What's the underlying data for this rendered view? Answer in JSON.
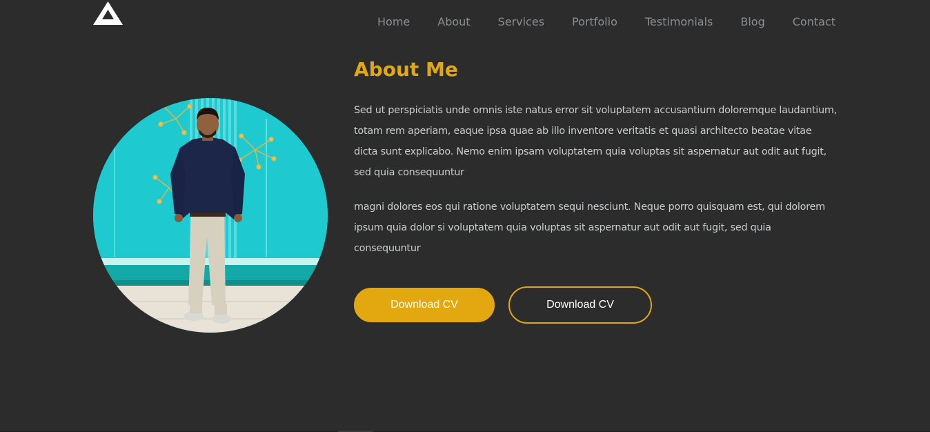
{
  "logo": {
    "icon": "logo-a-icon",
    "color": "#ffffff"
  },
  "nav": {
    "items": [
      "Home",
      "About",
      "Services",
      "Portfolio",
      "Testimonials",
      "Blog",
      "Contact"
    ]
  },
  "about": {
    "title": "About Me",
    "paragraph_1": "Sed ut perspiciatis unde omnis iste natus error sit voluptatem accusantium doloremque laudantium, totam rem aperiam, eaque ipsa quae ab illo inventore veritatis et quasi architecto beatae vitae dicta sunt explicabo. Nemo enim ipsam voluptatem quia voluptas sit aspernatur aut odit aut fugit, sed quia consequuntur",
    "paragraph_2": "magni dolores eos qui ratione voluptatem sequi nesciunt. Neque porro quisquam est, qui dolorem ipsum quia dolor si voluptatem quia voluptas sit aspernatur aut odit aut fugit, sed quia consequuntur",
    "primary_button": "Download CV",
    "outline_button": "Download CV"
  },
  "colors": {
    "background": "#2b2c2b",
    "accent": "#e3a80f",
    "nav_text": "#8b8d90",
    "body_text": "#c9cbcd"
  }
}
